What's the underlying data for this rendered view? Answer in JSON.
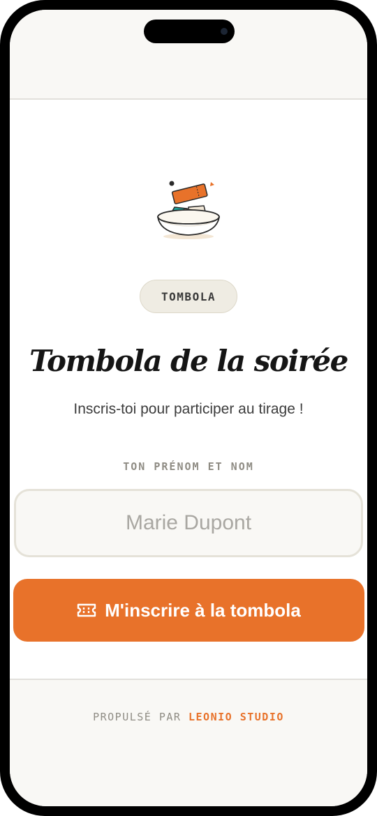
{
  "badge": {
    "label": "TOMBOLA"
  },
  "title": "Tombola de la soirée",
  "subtitle": "Inscris-toi pour participer au tirage !",
  "form": {
    "label": "TON PRÉNOM ET NOM",
    "input_value": "",
    "input_placeholder": "Marie Dupont",
    "submit_label": "M'inscrire à la tombola",
    "submit_icon": "ticket-icon"
  },
  "footer": {
    "prefix": "PROPULSÉ PAR",
    "brand": "LEONIO STUDIO"
  },
  "illustration": {
    "icon": "ticket-bowl-illustration"
  },
  "colors": {
    "accent": "#e8722a",
    "teal": "#1fa39a",
    "background": "#f9f8f5",
    "text": "#151515"
  }
}
